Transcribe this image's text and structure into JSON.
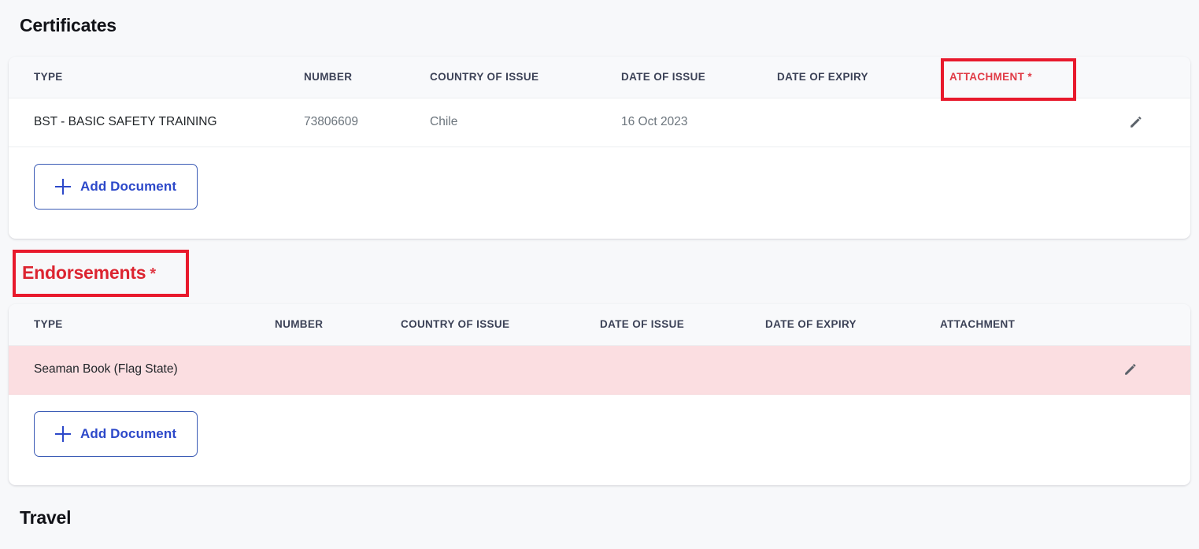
{
  "page": {
    "background_color": "#f7f8fa",
    "accent_blue": "#2c48c9",
    "danger_red": "#dc2430",
    "danger_row_bg": "#fbdee1",
    "highlight_box_color": "#e8192c"
  },
  "certificates": {
    "heading": "Certificates",
    "columns": [
      "TYPE",
      "NUMBER",
      "COUNTRY OF ISSUE",
      "DATE OF ISSUE",
      "DATE OF EXPIRY",
      "ATTACHMENT *",
      ""
    ],
    "attachment_required": true,
    "rows": [
      {
        "type": "BST - BASIC SAFETY TRAINING",
        "number": "73806609",
        "country_of_issue": "Chile",
        "date_of_issue": "16 Oct 2023",
        "date_of_expiry": "",
        "attachment": "",
        "edit_icon": "pencil-icon"
      }
    ],
    "add_button": {
      "label": "Add Document",
      "icon": "plus-icon"
    }
  },
  "endorsements": {
    "heading": "Endorsements",
    "heading_required_star": "*",
    "columns": [
      "TYPE",
      "NUMBER",
      "COUNTRY OF ISSUE",
      "DATE OF ISSUE",
      "DATE OF EXPIRY",
      "ATTACHMENT",
      ""
    ],
    "rows": [
      {
        "type": "Seaman Book (Flag State)",
        "number": "",
        "country_of_issue": "",
        "date_of_issue": "",
        "date_of_expiry": "",
        "attachment": "",
        "edit_icon": "pencil-icon",
        "state": "error"
      }
    ],
    "add_button": {
      "label": "Add Document",
      "icon": "plus-icon"
    }
  },
  "travel": {
    "heading": "Travel"
  }
}
